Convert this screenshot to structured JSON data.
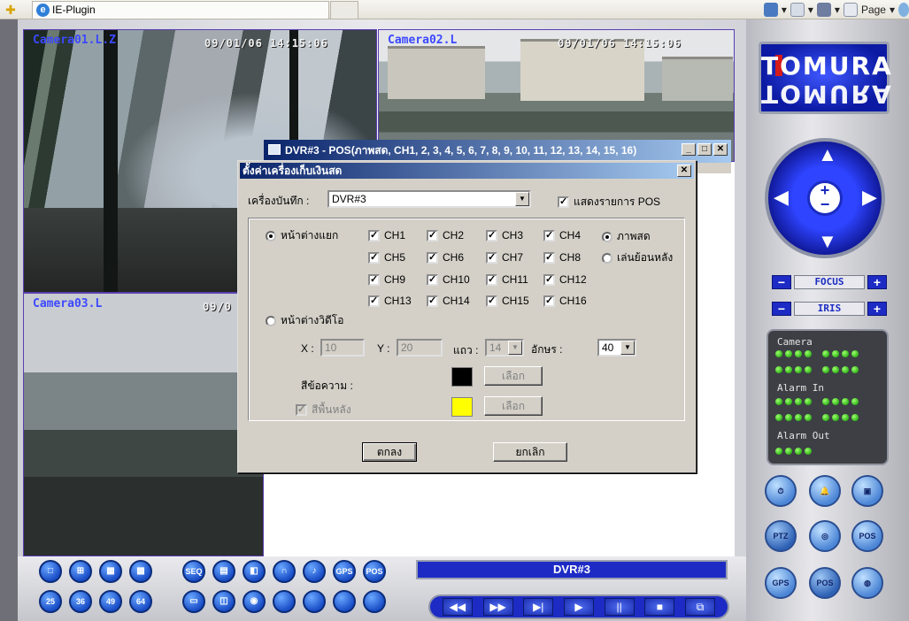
{
  "browser": {
    "tab_title": "IE-Plugin",
    "page_menu": "Page"
  },
  "cameras": [
    {
      "label": "Camera01.L.Z",
      "time": "09/01/06 14:15:06"
    },
    {
      "label": "Camera02.L",
      "time": "09/01/06 14:15:06"
    },
    {
      "label": "Camera03.L",
      "time": "09/0"
    }
  ],
  "status": {
    "device": "DVR#3"
  },
  "back_window": {
    "title": "DVR#3 - POS(ภาพสด, CH1, 2, 3, 4, 5, 6, 7, 8, 9, 10, 11, 12, 13, 14, 15, 16)"
  },
  "dialog": {
    "title": "ตั้งค่าเครื่องเก็บเงินสด",
    "recorder_label": "เครื่องบันทึก :",
    "recorder_value": "DVR#3",
    "show_pos_label": "แสดงรายการ POS",
    "show_pos_checked": true,
    "split_window_label": "หน้าต่างแยก",
    "video_window_label": "หน้าต่างวิดีโอ",
    "channels": [
      "CH1",
      "CH2",
      "CH3",
      "CH4",
      "CH5",
      "CH6",
      "CH7",
      "CH8",
      "CH9",
      "CH10",
      "CH11",
      "CH12",
      "CH13",
      "CH14",
      "CH15",
      "CH16"
    ],
    "live_label": "ภาพสด",
    "playback_label": "เล่นย้อนหลัง",
    "x_label": "X :",
    "x_value": "10",
    "y_label": "Y :",
    "y_value": "20",
    "row_label": "แถว :",
    "row_value": "14",
    "chars_label": "อักษร :",
    "chars_value": "40",
    "text_color_label": "สีข้อความ :",
    "bg_color_label": "สีพื้นหลัง",
    "choose_label": "เลือก",
    "ok_label": "ตกลง",
    "cancel_label": "ยกเลิก",
    "text_color": "#000000",
    "bg_color": "#ffff00"
  },
  "panel": {
    "logo": "TOMURA",
    "focus_label": "FOCUS",
    "iris_label": "IRIS",
    "camera_label": "Camera",
    "alarm_in_label": "Alarm In",
    "alarm_out_label": "Alarm Out",
    "led_color": "#44cc22"
  },
  "bottom": {
    "layout_buttons": [
      "25",
      "36",
      "49",
      "64"
    ],
    "seq_label": "SEQ",
    "pos_label": "POS",
    "gps_label": "GPS",
    "ptz_label": "PTZ",
    "play_controls": [
      "◀◀",
      "▶▶",
      "▶|",
      "▶",
      "||",
      "■",
      "⧉"
    ]
  }
}
